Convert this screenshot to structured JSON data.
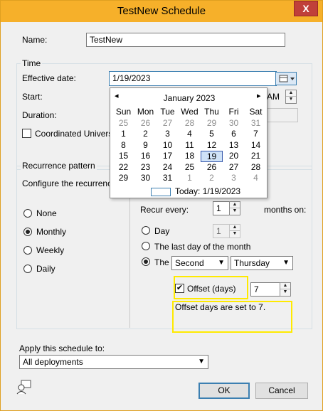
{
  "window": {
    "title": "TestNew Schedule",
    "close_glyph": "X"
  },
  "name_label": "Name:",
  "name_value": "TestNew",
  "time": {
    "group_title": "Time",
    "effective_label": "Effective date:",
    "effective_value": "1/19/2023",
    "start_label": "Start:",
    "start_suffix": "AM",
    "duration_label": "Duration:",
    "utc_label": "Coordinated Universal"
  },
  "calendar": {
    "month_label": "January 2023",
    "prev_glyph": "◂",
    "next_glyph": "▸",
    "weekdays": [
      "Sun",
      "Mon",
      "Tue",
      "Wed",
      "Thu",
      "Fri",
      "Sat"
    ],
    "weeks": [
      [
        "25",
        "26",
        "27",
        "28",
        "29",
        "30",
        "31"
      ],
      [
        "1",
        "2",
        "3",
        "4",
        "5",
        "6",
        "7"
      ],
      [
        "8",
        "9",
        "10",
        "11",
        "12",
        "13",
        "14"
      ],
      [
        "15",
        "16",
        "17",
        "18",
        "19",
        "20",
        "21"
      ],
      [
        "22",
        "23",
        "24",
        "25",
        "26",
        "27",
        "28"
      ],
      [
        "29",
        "30",
        "31",
        "1",
        "2",
        "3",
        "4"
      ]
    ],
    "selected_day": "19",
    "today_label": "Today: 1/19/2023"
  },
  "recurrence": {
    "group_title": "Recurrence pattern",
    "configure_label": "Configure the recurrence s",
    "options": [
      "None",
      "Monthly",
      "Weekly",
      "Daily"
    ],
    "selected": "Monthly",
    "recur_every_label": "Recur every:",
    "recur_every_value": "1",
    "months_on_label": "months on:",
    "day_label": "Day",
    "day_value": "1",
    "last_day_label": "The last day of the month",
    "the_label": "The",
    "week_ordinal": "Second",
    "weekday": "Thursday",
    "offset_label": "Offset (days)",
    "offset_checked": true,
    "offset_value": "7",
    "offset_message": "Offset days are set to 7."
  },
  "apply": {
    "label": "Apply this schedule to:",
    "value": "All deployments"
  },
  "buttons": {
    "ok": "OK",
    "cancel": "Cancel"
  },
  "icons": {
    "help": "user-help-icon",
    "calendar": "calendar-icon"
  },
  "colors": {
    "titlebar": "#f6b02a",
    "close": "#c0403a",
    "highlight": "#ffea00",
    "selected_day": "#cfe2f7"
  }
}
